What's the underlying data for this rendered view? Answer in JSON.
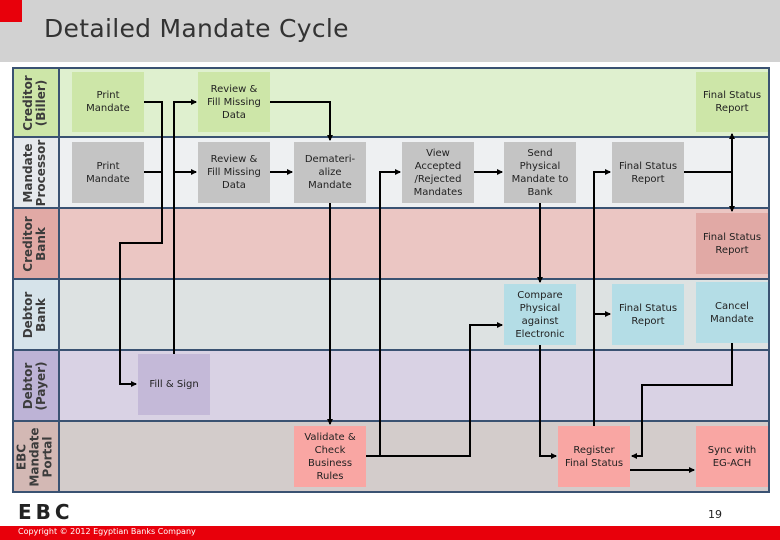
{
  "header": {
    "title": "Detailed Mandate Cycle"
  },
  "lanes": [
    {
      "label": "Creditor\n(Biller)",
      "color": "#dff0cf",
      "label_color": "#cde6a8"
    },
    {
      "label": "Mandate\nProcessor",
      "color": "#eef0f2",
      "label_color": "#e6e9ed"
    },
    {
      "label": "Creditor\nBank",
      "color": "#ebc6c3",
      "label_color": "#e1a9a5"
    },
    {
      "label": "Debtor\nBank",
      "color": "#dde2e2",
      "label_color": "#d6e3ea"
    },
    {
      "label": "Debtor\n(Payer)",
      "color": "#d9d2e4",
      "label_color": "#bdb3d6"
    },
    {
      "label": "EBC\nMandate\nPortal",
      "color": "#d3cccb",
      "label_color": "#d3b8b4"
    }
  ],
  "boxes": {
    "creditor_print": "Print\nMandate",
    "creditor_review": "Review &\nFill Missing\nData",
    "creditor_final": "Final Status\nReport",
    "processor_print": "Print\nMandate",
    "processor_review": "Review &\nFill Missing\nData",
    "processor_demat": "Demateri-\nalize\nMandate",
    "processor_view": "View\nAccepted\n/Rejected\nMandates",
    "processor_send": "Send\nPhysical\nMandate to\nBank",
    "processor_final": "Final Status\nReport",
    "creditor_bank_final": "Final Status\nReport",
    "debtor_bank_compare": "Compare\nPhysical\nagainst\nElectronic",
    "debtor_bank_final": "Final Status\nReport",
    "debtor_bank_cancel": "Cancel\nMandate",
    "payer_fill": "Fill & Sign",
    "portal_validate": "Validate &\nCheck\nBusiness\nRules",
    "portal_register": "Register\nFinal Status",
    "portal_sync": "Sync with\nEG-ACH"
  },
  "footer": {
    "logo": "EBC",
    "page_number": "19",
    "copyright": "Copyright © 2012 Egyptian Banks Company"
  }
}
